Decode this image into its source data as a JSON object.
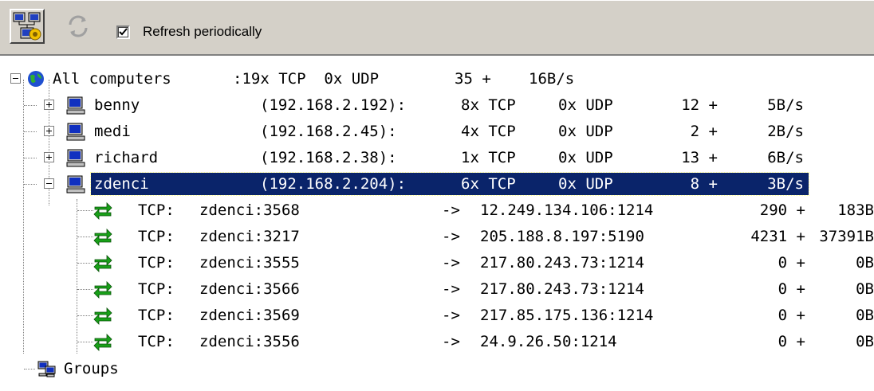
{
  "toolbar": {
    "buttons": [
      {
        "icon": "network-settings-icon"
      },
      {
        "icon": "refresh-icon"
      }
    ],
    "refresh_checkbox": {
      "label": "Refresh periodically",
      "checked": true
    }
  },
  "tree": {
    "root": {
      "name": "All computers",
      "summary": ":19x TCP  0x UDP",
      "traffic_in": "35 +",
      "traffic_rate": "16B/s",
      "icon": "globe-icon",
      "expanded": true
    },
    "computers": [
      {
        "name": "benny",
        "ip": "(192.168.2.192):",
        "tcp": "8x TCP",
        "udp": "0x UDP",
        "in": "12 +",
        "rate": "5B/s",
        "expanded": false,
        "selected": false
      },
      {
        "name": "medi",
        "ip": "(192.168.2.45):",
        "tcp": "4x TCP",
        "udp": "0x UDP",
        "in": "2 +",
        "rate": "2B/s",
        "expanded": false,
        "selected": false
      },
      {
        "name": "richard",
        "ip": "(192.168.2.38):",
        "tcp": "1x TCP",
        "udp": "0x UDP",
        "in": "13 +",
        "rate": "6B/s",
        "expanded": false,
        "selected": false
      },
      {
        "name": "zdenci",
        "ip": "(192.168.2.204):",
        "tcp": "6x TCP",
        "udp": "0x UDP",
        "in": "8 +",
        "rate": "3B/s",
        "expanded": true,
        "selected": true
      }
    ],
    "connections": [
      {
        "proto": "TCP:",
        "local": "zdenci:3568",
        "arrow": "->",
        "remote": "12.249.134.106:1214",
        "in": "290 +",
        "bytes": "183B"
      },
      {
        "proto": "TCP:",
        "local": "zdenci:3217",
        "arrow": "->",
        "remote": "205.188.8.197:5190",
        "in": "4231 +",
        "bytes": "37391B"
      },
      {
        "proto": "TCP:",
        "local": "zdenci:3555",
        "arrow": "->",
        "remote": "217.80.243.73:1214",
        "in": "0 +",
        "bytes": "0B"
      },
      {
        "proto": "TCP:",
        "local": "zdenci:3566",
        "arrow": "->",
        "remote": "217.80.243.73:1214",
        "in": "0 +",
        "bytes": "0B"
      },
      {
        "proto": "TCP:",
        "local": "zdenci:3569",
        "arrow": "->",
        "remote": "217.85.175.136:1214",
        "in": "0 +",
        "bytes": "0B"
      },
      {
        "proto": "TCP:",
        "local": "zdenci:3556",
        "arrow": "->",
        "remote": "24.9.26.50:1214",
        "in": "0 +",
        "bytes": "0B"
      }
    ],
    "groups": {
      "name": "Groups",
      "icon": "groups-icon"
    }
  },
  "colors": {
    "selection": "#0a246a",
    "toolbar_bg": "#d4d0c8",
    "connection_arrow": "#18a018"
  }
}
